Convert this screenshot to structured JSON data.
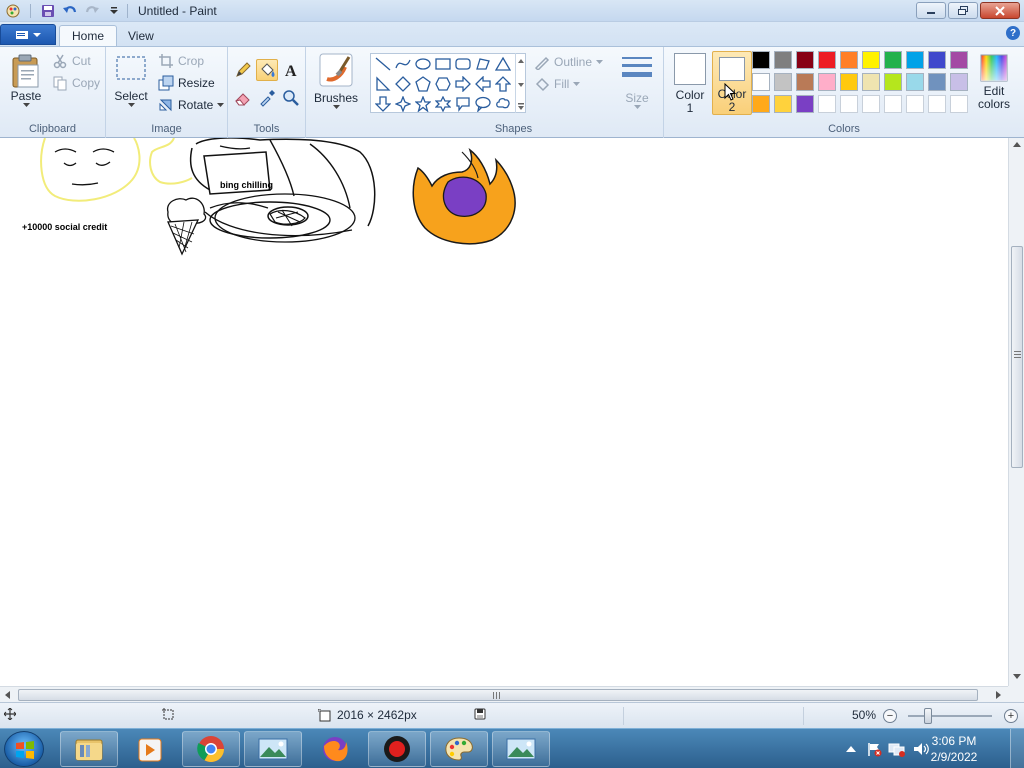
{
  "window": {
    "title": "Untitled - Paint"
  },
  "tabs": {
    "home": "Home",
    "view": "View"
  },
  "clipboard": {
    "group_label": "Clipboard",
    "paste": "Paste",
    "cut": "Cut",
    "copy": "Copy"
  },
  "image": {
    "group_label": "Image",
    "select": "Select",
    "crop": "Crop",
    "resize": "Resize",
    "rotate": "Rotate"
  },
  "tools": {
    "group_label": "Tools"
  },
  "brushes": {
    "label": "Brushes"
  },
  "shapes": {
    "group_label": "Shapes",
    "outline": "Outline",
    "fill": "Fill"
  },
  "size": {
    "label": "Size"
  },
  "colors": {
    "group_label": "Colors",
    "color1_label": "Color",
    "color1_num": "1",
    "color2_label": "Color",
    "color2_num": "2",
    "edit_label": "Edit",
    "edit_label2": "colors",
    "palette_row1": [
      "#000000",
      "#7f7f7f",
      "#880015",
      "#ed1c24",
      "#ff7f27",
      "#fff200",
      "#22b14c",
      "#00a2e8",
      "#3f48cc",
      "#a349a4"
    ],
    "palette_row2": [
      "#ffffff",
      "#c3c3c3",
      "#b97a57",
      "#ffaec9",
      "#ffc90e",
      "#efe4b0",
      "#b5e61d",
      "#99d9ea",
      "#7092be",
      "#c8bfe7"
    ],
    "palette_row3": [
      "#ffa91a",
      "#ffd23c",
      "#7a3fc4",
      "#ffffff",
      "#ffffff",
      "#ffffff",
      "#ffffff",
      "#ffffff",
      "#ffffff",
      "#ffffff"
    ]
  },
  "canvas": {
    "text_social": "+10000 social credit",
    "text_bing": "bing chilling"
  },
  "status": {
    "dimensions": "2016 × 2462px",
    "zoom": "50%"
  },
  "taskbar": {
    "time": "3:06 PM",
    "date": "2/9/2022"
  }
}
